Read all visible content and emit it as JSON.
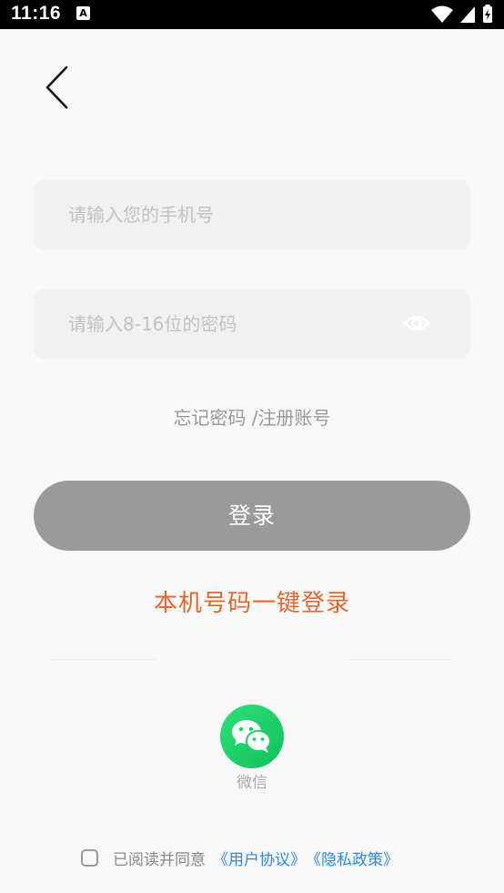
{
  "status_bar": {
    "time": "11:16",
    "app_icon_glyph": "A"
  },
  "phone_input": {
    "placeholder": "请输入您的手机号",
    "value": ""
  },
  "password_input": {
    "placeholder": "请输入8-16位的密码",
    "value": ""
  },
  "forgot_link": "忘记密码 /注册账号",
  "login_button": "登录",
  "onekey_login": "本机号码一键登录",
  "wechat": {
    "label": "微信"
  },
  "agreement": {
    "text": "已阅读并同意",
    "user_agreement": "《用户协议》",
    "privacy_policy": "《隐私政策》"
  },
  "colors": {
    "accent_orange": "#e3672a",
    "link_blue": "#2a8ae6",
    "button_gray": "#9a9a9a",
    "wechat_green": "#1ed065"
  }
}
